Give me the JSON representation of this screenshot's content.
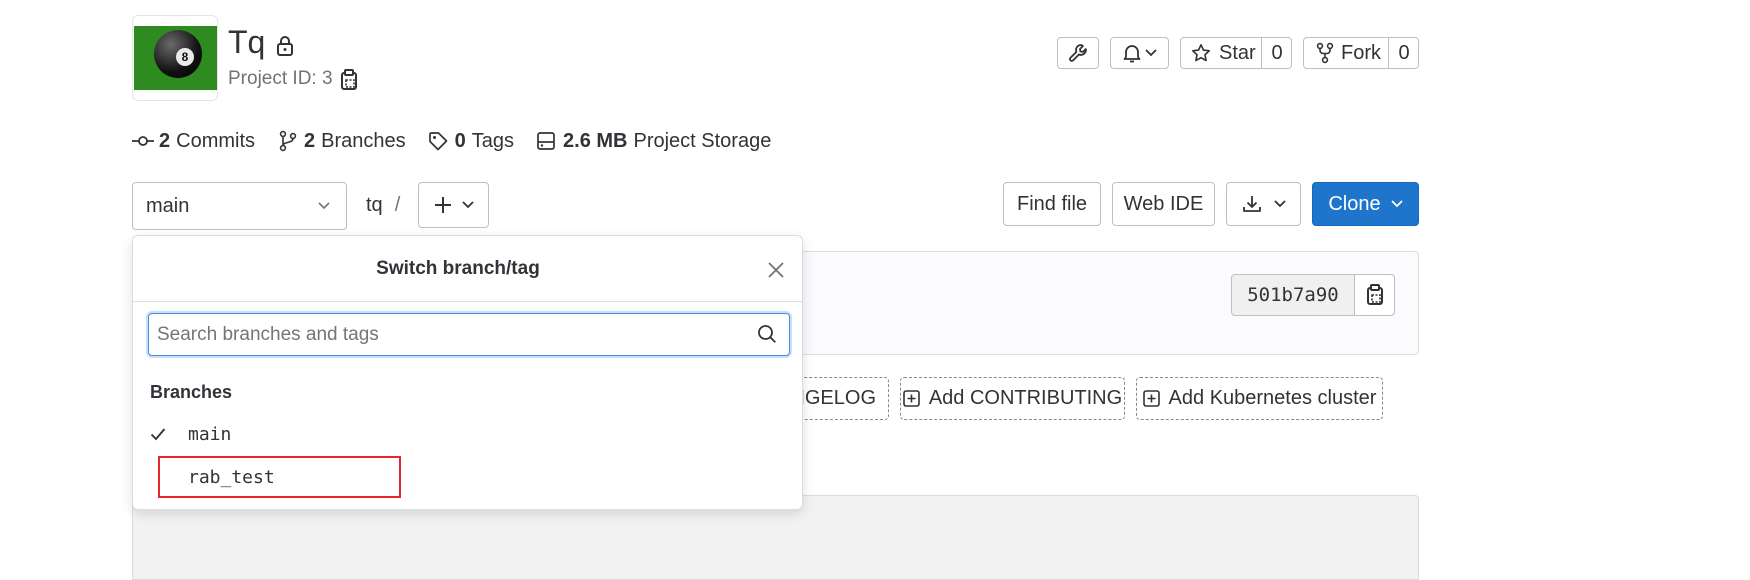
{
  "project": {
    "name": "Tq",
    "id_label": "Project ID: 3"
  },
  "header_actions": {
    "star_label": "Star",
    "star_count": "0",
    "fork_label": "Fork",
    "fork_count": "0"
  },
  "stats": {
    "commits_count": "2",
    "commits_label": "Commits",
    "branches_count": "2",
    "branches_label": "Branches",
    "tags_count": "0",
    "tags_label": "Tags",
    "storage_size": "2.6 MB",
    "storage_label": "Project Storage"
  },
  "repo_nav": {
    "branch_selected": "main",
    "path_root": "tq",
    "path_sep": "/",
    "find_file": "Find file",
    "web_ide": "Web IDE",
    "clone": "Clone"
  },
  "commit": {
    "sha": "501b7a90"
  },
  "quick_actions": {
    "changelog_partial": "NGELOG",
    "add_contributing": "Add CONTRIBUTING",
    "add_kubernetes": "Add Kubernetes cluster"
  },
  "branch_dropdown": {
    "title": "Switch branch/tag",
    "search_placeholder": "Search branches and tags",
    "section_title": "Branches",
    "items": [
      {
        "label": "main",
        "checked": true
      },
      {
        "label": "rab_test",
        "checked": false,
        "highlighted": true
      }
    ]
  },
  "colors": {
    "primary": "#1f75cb",
    "highlight": "#e3262f",
    "avatar_green": "#2e8b1f"
  }
}
